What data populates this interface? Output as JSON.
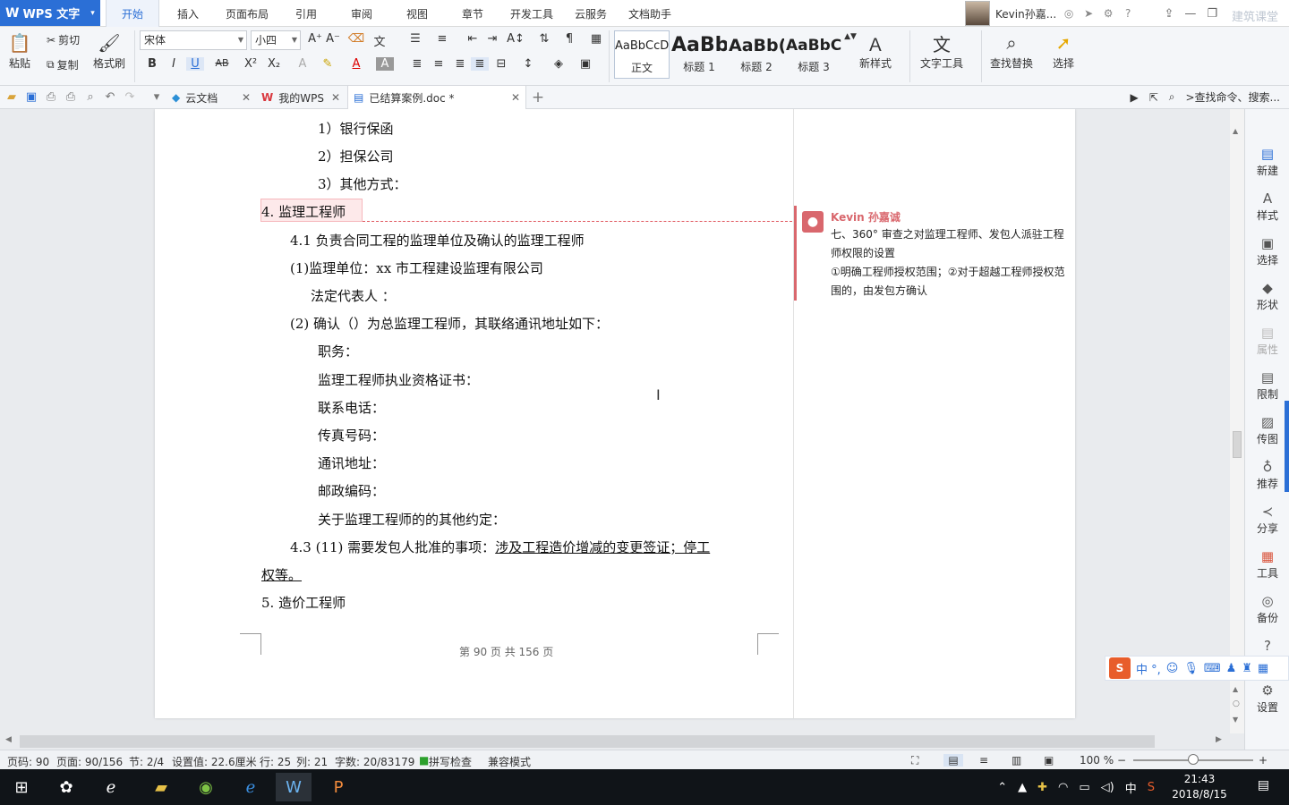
{
  "app": {
    "logo_label": "WPS 文字",
    "menu_tabs": [
      "开始",
      "插入",
      "页面布局",
      "引用",
      "审阅",
      "视图",
      "章节",
      "开发工具",
      "云服务",
      "文档助手"
    ],
    "active_tab": "开始",
    "user_name": "Kevin孙嘉...",
    "watermark": "建筑课堂"
  },
  "ribbon": {
    "paste": "粘贴",
    "cut": "剪切",
    "copy": "复制",
    "format_painter": "格式刷",
    "font_name": "宋体",
    "font_size": "小四",
    "styles": [
      {
        "sample": "AaBbCcD",
        "name": "正文"
      },
      {
        "sample": "AaBb",
        "name": "标题 1"
      },
      {
        "sample": "AaBb(",
        "name": "标题 2"
      },
      {
        "sample": "AaBbC",
        "name": "标题 3"
      }
    ],
    "new_style": "新样式",
    "text_tools": "文字工具",
    "find_replace": "查找替换",
    "select": "选择"
  },
  "tabs": {
    "items": [
      {
        "label": "云文档"
      },
      {
        "label": "我的WPS"
      },
      {
        "label": "已结算案例.doc *"
      }
    ],
    "search_placeholder": ">查找命令、搜索..."
  },
  "document": {
    "lines": [
      "1）银行保函",
      "2）担保公司",
      "3）其他方式：",
      "4.  监理工程师",
      "4.1  负责合同工程的监理单位及确认的监理工程师",
      "(1)监理单位：xx 市工程建设监理有限公司",
      "法定代表人 ：",
      "(2) 确认（）为总监理工程师，其联络通讯地址如下：",
      "职务：",
      "监理工程师执业资格证书：",
      "联系电话：",
      "传真号码：",
      "通讯地址：",
      "邮政编码：",
      "关于监理工程师的的其他约定：",
      "4.3   (11) 需要发包人批准的事项：",
      "涉及工程造价增减的变更签证；停工",
      "权等。",
      "5.  造价工程师"
    ],
    "page_footer": "第 90 页 共 156 页"
  },
  "comment": {
    "author": "Kevin 孙嘉诚",
    "text": "七、360° 审查之对监理工程师、发包人派驻工程师权限的设置\n①明确工程师授权范围；②对于超越工程师授权范围的，由发包方确认"
  },
  "taskpane": {
    "items": [
      {
        "label": "新建"
      },
      {
        "label": "样式"
      },
      {
        "label": "选择"
      },
      {
        "label": "形状"
      },
      {
        "label": "属性"
      },
      {
        "label": "限制"
      },
      {
        "label": "传图"
      },
      {
        "label": "推荐"
      },
      {
        "label": "分享"
      },
      {
        "label": "工具"
      },
      {
        "label": "备份"
      },
      {
        "label": "帮助"
      },
      {
        "label": "设置"
      }
    ]
  },
  "ime": {
    "labels": "中 °,"
  },
  "status": {
    "page_code": "页码: 90",
    "page": "页面: 90/156",
    "section": "节: 2/4",
    "setting": "设置值: 22.6厘米",
    "row": "行: 25",
    "col": "列: 21",
    "words": "字数: 20/83179",
    "spellcheck": "拼写检查",
    "compat": "兼容模式",
    "zoom": "100 %"
  },
  "taskbar": {
    "time": "21:43",
    "date": "2018/8/15",
    "ime_tray": "中"
  }
}
